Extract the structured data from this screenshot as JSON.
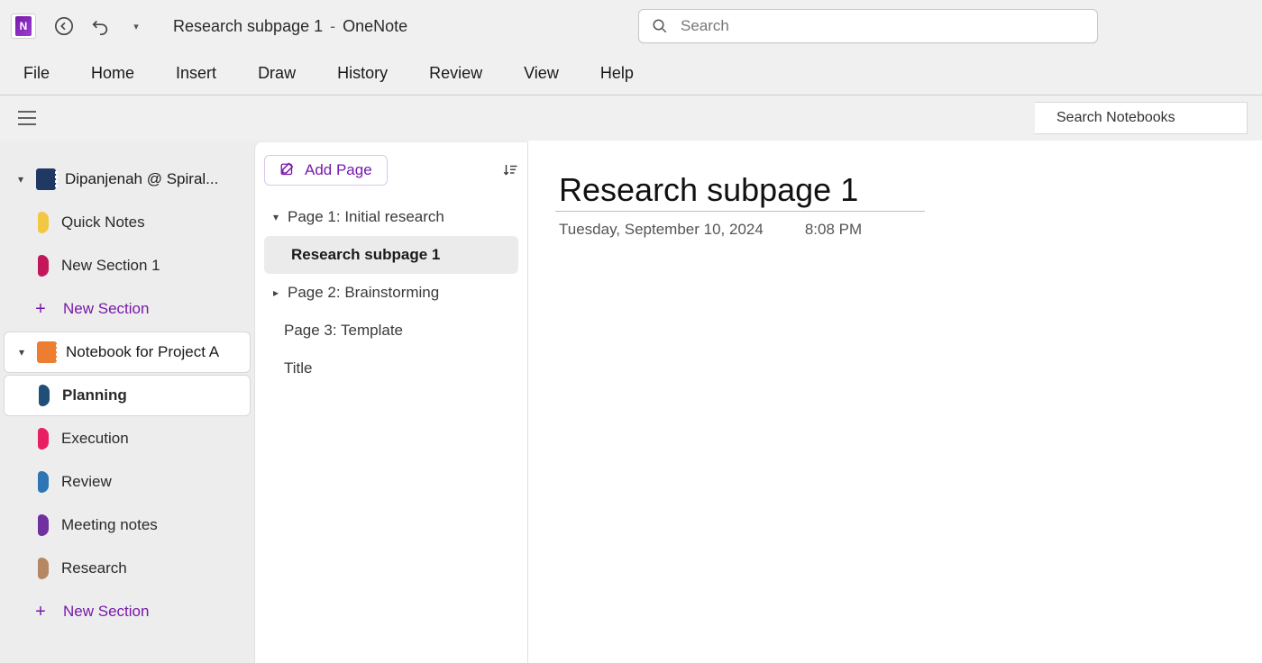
{
  "title": {
    "page": "Research subpage 1",
    "separator": "-",
    "app": "OneNote"
  },
  "search": {
    "placeholder": "Search"
  },
  "menubar": [
    "File",
    "Home",
    "Insert",
    "Draw",
    "History",
    "Review",
    "View",
    "Help"
  ],
  "searchNotebooks": {
    "placeholder": "Search Notebooks"
  },
  "sidebar": {
    "notebooks": [
      {
        "name": "Dipanjenah @ Spiral...",
        "color": "#203864",
        "expanded": true,
        "sections": [
          {
            "name": "Quick Notes",
            "color": "#F2C744"
          },
          {
            "name": "New Section 1",
            "color": "#C2185B"
          }
        ],
        "addSectionLabel": "New Section"
      },
      {
        "name": "Notebook for Project A",
        "color": "#ED7D31",
        "expanded": true,
        "active": true,
        "sections": [
          {
            "name": "Planning",
            "color": "#1F4E79",
            "active": true
          },
          {
            "name": "Execution",
            "color": "#E91E63"
          },
          {
            "name": "Review",
            "color": "#2E75B6"
          },
          {
            "name": "Meeting notes",
            "color": "#7030A0"
          },
          {
            "name": "Research",
            "color": "#B58863"
          }
        ],
        "addSectionLabel": "New Section"
      }
    ]
  },
  "pageList": {
    "addPageLabel": "Add Page",
    "items": [
      {
        "label": "Page 1: Initial research",
        "arrow": "down",
        "level": 1
      },
      {
        "label": "Research subpage 1",
        "arrow": "none",
        "level": 2,
        "selected": true
      },
      {
        "label": "Page 2: Brainstorming",
        "arrow": "right",
        "level": 1
      },
      {
        "label": "Page 3: Template",
        "arrow": "none",
        "level": 1
      },
      {
        "label": "Title",
        "arrow": "none",
        "level": 1
      }
    ]
  },
  "canvas": {
    "title": "Research subpage 1",
    "date": "Tuesday, September 10, 2024",
    "time": "8:08 PM"
  }
}
